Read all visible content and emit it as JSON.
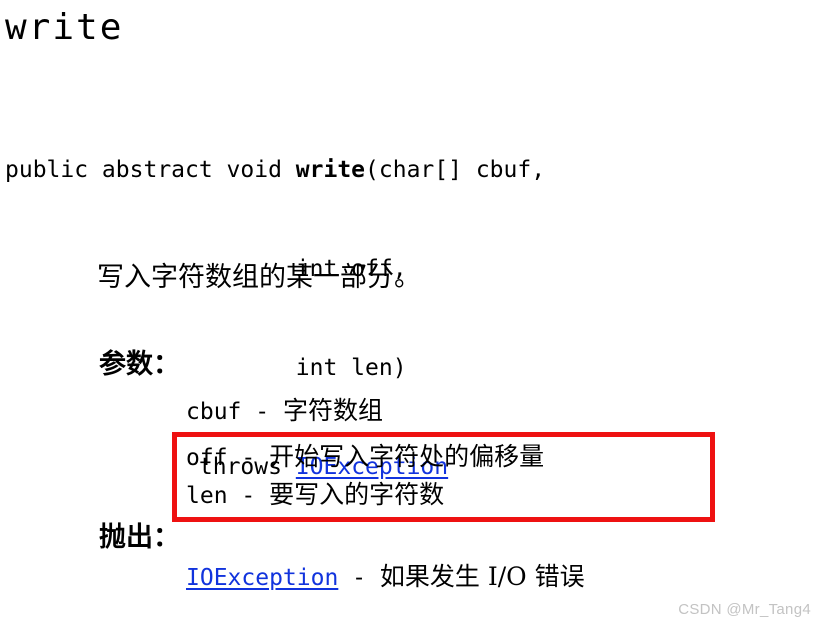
{
  "title": "write",
  "signature": {
    "line1_prefix": "public abstract void ",
    "line1_name": "write",
    "line1_suffix": "(char[] cbuf,",
    "line2": "int off,",
    "line3": "int len)",
    "line4_keyword": "throws ",
    "line4_link": "IOException"
  },
  "description": "写入字符数组的某一部分。",
  "params": {
    "label": "参数：",
    "items": [
      {
        "name": "cbuf",
        "sep": " - ",
        "desc": "字符数组",
        "highlighted": false
      },
      {
        "name": "off",
        "sep": " - ",
        "desc": "开始写入字符处的偏移量",
        "highlighted": true
      },
      {
        "name": "len",
        "sep": " - ",
        "desc": "要写入的字符数",
        "highlighted": true
      }
    ]
  },
  "throws": {
    "label": "抛出：",
    "items": [
      {
        "name": "IOException",
        "sep": " - ",
        "desc": "如果发生 I/O 错误"
      }
    ]
  },
  "annotation": {
    "color": "#ee1111",
    "shape": "rectangle"
  },
  "link_color": "#1133dd",
  "watermark": "CSDN @Mr_Tang4"
}
